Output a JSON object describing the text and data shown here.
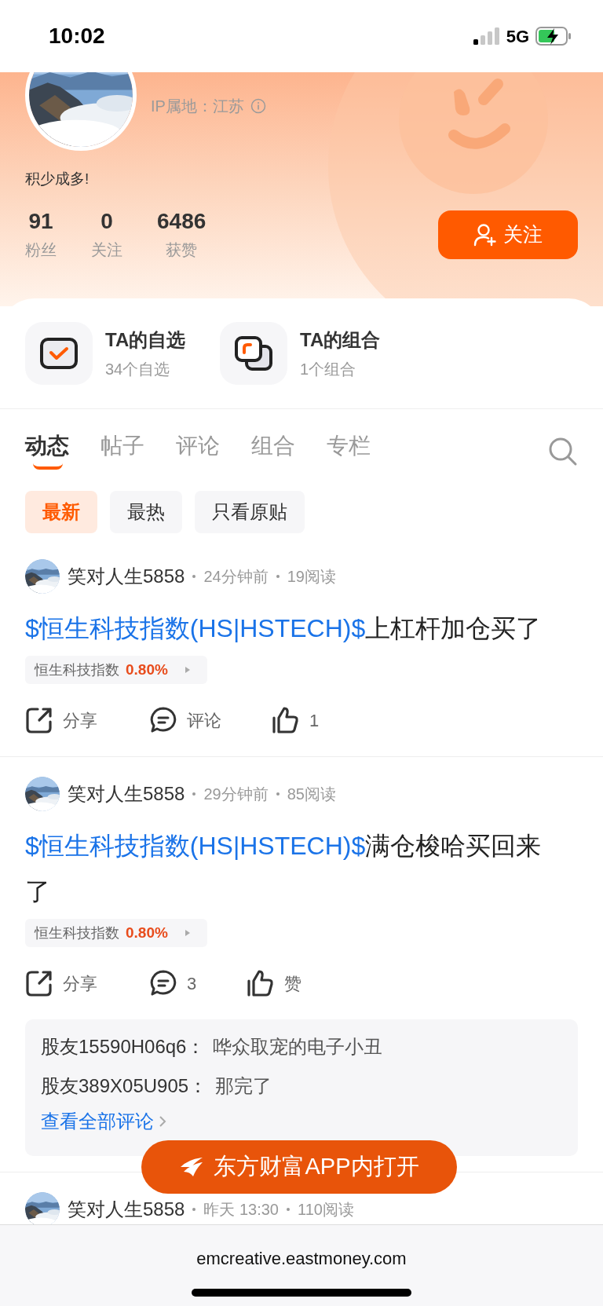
{
  "status_bar": {
    "time": "10:02",
    "network": "5G"
  },
  "profile": {
    "ip_location": "IP属地：江苏",
    "bio": "积少成多!",
    "stats": [
      {
        "value": "91",
        "label": "粉丝"
      },
      {
        "value": "0",
        "label": "关注"
      },
      {
        "value": "6486",
        "label": "获赞"
      }
    ],
    "follow_button": "关注"
  },
  "shortcuts": [
    {
      "kind": "watchlist",
      "title": "TA的自选",
      "subtitle": "34个自选"
    },
    {
      "kind": "portfolio",
      "title": "TA的组合",
      "subtitle": "1个组合"
    }
  ],
  "tabs": [
    {
      "label": "动态",
      "selected": true
    },
    {
      "label": "帖子",
      "selected": false
    },
    {
      "label": "评论",
      "selected": false
    },
    {
      "label": "组合",
      "selected": false
    },
    {
      "label": "专栏",
      "selected": false
    }
  ],
  "filters": [
    {
      "label": "最新",
      "selected": true
    },
    {
      "label": "最热",
      "selected": false
    },
    {
      "label": "只看原贴",
      "selected": false
    }
  ],
  "posts": [
    {
      "author": "笑对人生5858",
      "time": "24分钟前",
      "reads": "19阅读",
      "stock_link": "$恒生科技指数(HS|HSTECH)$",
      "text": "上杠杆加仓买了",
      "quote": {
        "name": "恒生科技指数",
        "change": "0.80%"
      },
      "actions": {
        "share": "分享",
        "comment": "评论",
        "like": "1"
      }
    },
    {
      "author": "笑对人生5858",
      "time": "29分钟前",
      "reads": "85阅读",
      "stock_link": "$恒生科技指数(HS|HSTECH)$",
      "text": "满仓梭哈买回来了",
      "quote": {
        "name": "恒生科技指数",
        "change": "0.80%"
      },
      "actions": {
        "share": "分享",
        "comment": "3",
        "like": "赞"
      },
      "comments": [
        {
          "user": "股友15590H06q6：",
          "text": "哗众取宠的电子小丑"
        },
        {
          "user": "股友389X05U905：",
          "text": "那完了"
        }
      ],
      "more_comments": "查看全部评论"
    },
    {
      "author": "笑对人生5858",
      "time": "昨天 13:30",
      "reads": "110阅读"
    }
  ],
  "open_in_app_button": "东方财富APP内打开",
  "browser": {
    "url": "emcreative.eastmoney.com"
  }
}
